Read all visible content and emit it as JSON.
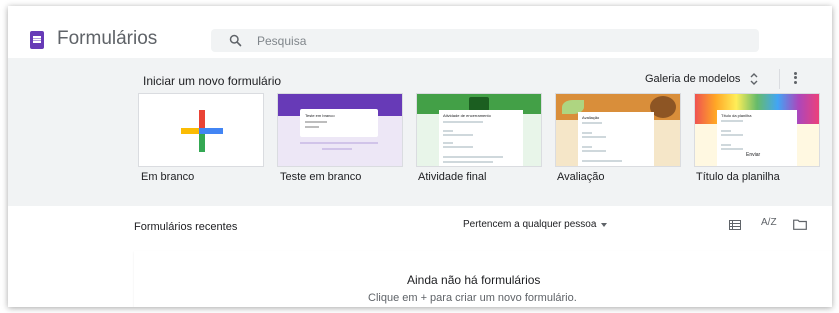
{
  "header": {
    "app_title": "Formulários",
    "search_placeholder": "Pesquisa",
    "logo_icon": "forms-icon",
    "search_icon": "search-icon"
  },
  "gallery": {
    "title": "Iniciar um novo formulário",
    "toggle_label": "Galeria de modelos",
    "toggle_icon": "unfold-more-icon",
    "more_icon": "more-vert-icon",
    "templates": [
      {
        "label": "Em branco",
        "thumbnail": "plus-icon"
      },
      {
        "label": "Teste em branco",
        "thumbnail": "purple-quiz-preview",
        "preview_title": "Teste em branco"
      },
      {
        "label": "Atividade final",
        "thumbnail": "green-activity-preview",
        "preview_title": "Atividade de encerramento"
      },
      {
        "label": "Avaliação",
        "thumbnail": "orange-evaluation-preview",
        "preview_title": "Avaliação"
      },
      {
        "label": "Título da planilha",
        "thumbnail": "colorful-spreadsheet-preview",
        "preview_title": "Título da planilha",
        "preview_text": "Enviar"
      }
    ]
  },
  "recent": {
    "title": "Formulários recentes",
    "owner_filter": "Pertencem a qualquer pessoa",
    "view_icon": "list-view-icon",
    "sort_icon": "sort-az-icon",
    "sort_label": "A/Z",
    "folder_icon": "folder-icon",
    "empty_title": "Ainda não há formulários",
    "empty_subtitle": "Clique em + para criar um novo formulário."
  },
  "colors": {
    "brand": "#673ab7",
    "gallery_bg": "#f1f3f4",
    "plus_red": "#ea4335",
    "plus_blue": "#4285f4",
    "plus_yellow": "#fbbc04",
    "plus_green": "#34a853"
  }
}
